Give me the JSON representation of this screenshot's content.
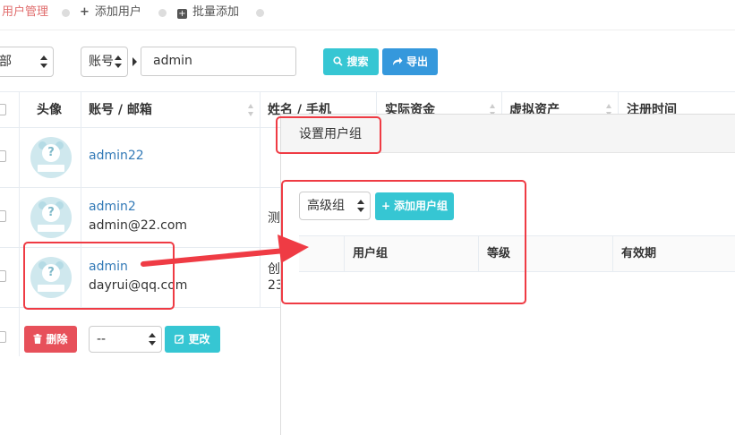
{
  "tabs": [
    {
      "label": "用户管理",
      "active": true
    },
    {
      "label": "添加用户",
      "icon": "plus-icon"
    },
    {
      "label": "批量添加",
      "icon": "plus-square-icon"
    }
  ],
  "filters": {
    "group_select_value": "部",
    "field_select_value": "账号",
    "search_value": "admin",
    "search_button": "搜索",
    "export_button": "导出"
  },
  "table": {
    "headers": [
      "头像",
      "账号 / 邮箱",
      "姓名 / 手机",
      "实际资金",
      "虚拟资产",
      "注册时间"
    ],
    "rows": [
      {
        "account": "admin22",
        "email": "",
        "name": "",
        "phone": ""
      },
      {
        "account": "admin2",
        "email": "admin@22.com",
        "name": "测",
        "phone": ""
      },
      {
        "account": "admin",
        "email": "dayrui@qq.com",
        "name": "创",
        "phone": "23"
      }
    ]
  },
  "footer": {
    "delete_button": "删除",
    "batch_select_value": "--",
    "change_button": "更改"
  },
  "modal": {
    "title": "设置用户组",
    "group_level_select": "高级组",
    "add_group_button": "添加用户组",
    "table_headers": [
      "用户组",
      "等级",
      "有效期"
    ]
  },
  "colors": {
    "accent_cyan": "#36c6d3",
    "accent_blue": "#3598dc",
    "danger_red": "#e7505a",
    "active_tab": "#e06c6c",
    "annotation_red": "#ef3b44"
  }
}
